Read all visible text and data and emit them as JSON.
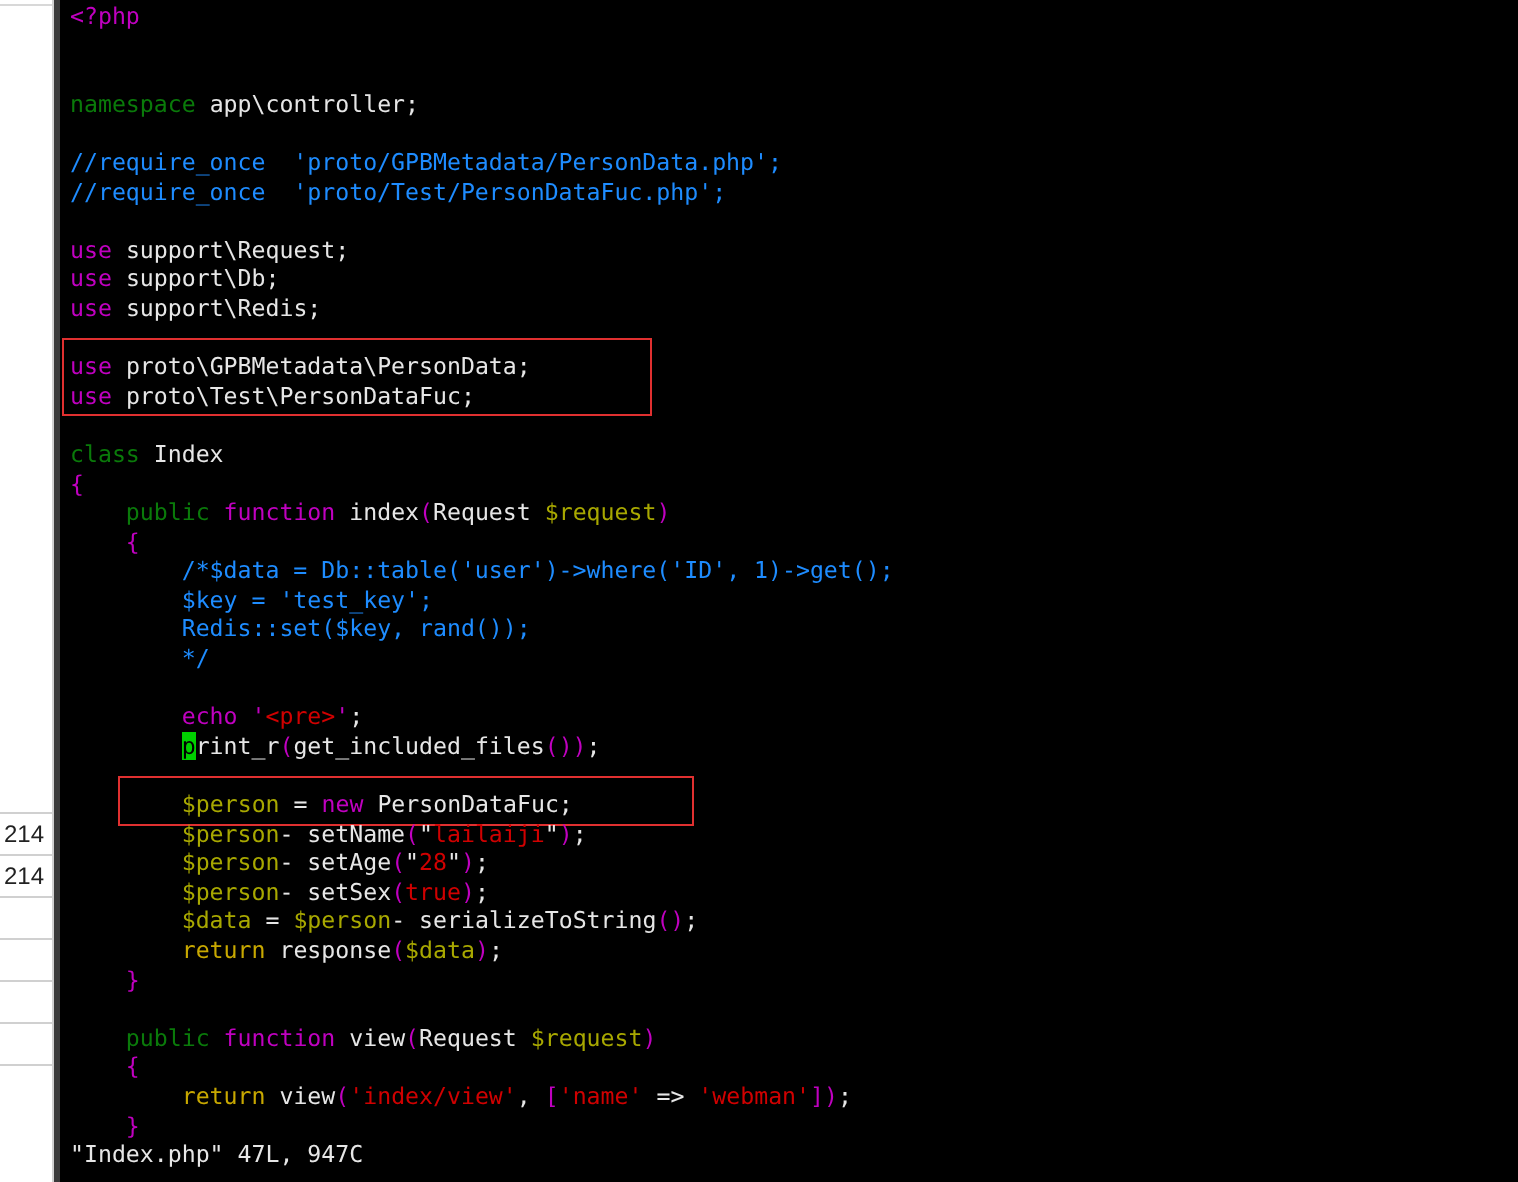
{
  "side_table": {
    "rows": [
      {
        "cell": "214"
      },
      {
        "cell": "214"
      }
    ]
  },
  "editor": {
    "blocks": [
      {
        "boxed": false,
        "lines": [
          {
            "kind": "code",
            "tokens": [
              {
                "kind": "statement",
                "text": "<?php"
              }
            ]
          },
          {
            "kind": "blank"
          },
          {
            "kind": "blank"
          },
          {
            "kind": "code",
            "tokens": [
              {
                "kind": "keyword",
                "text": "namespace"
              },
              {
                "kind": "text",
                "text": " app\\controller;"
              }
            ]
          },
          {
            "kind": "blank"
          },
          {
            "kind": "code",
            "tokens": [
              {
                "kind": "comment",
                "text": "//require_once  'proto/GPBMetadata/PersonData.php';"
              }
            ]
          },
          {
            "kind": "code",
            "tokens": [
              {
                "kind": "comment",
                "text": "//require_once  'proto/Test/PersonDataFuc.php';"
              }
            ]
          },
          {
            "kind": "blank"
          },
          {
            "kind": "code",
            "tokens": [
              {
                "kind": "statement",
                "text": "use"
              },
              {
                "kind": "text",
                "text": " support\\Request;"
              }
            ]
          },
          {
            "kind": "code",
            "tokens": [
              {
                "kind": "statement",
                "text": "use"
              },
              {
                "kind": "text",
                "text": " support\\Db;"
              }
            ]
          },
          {
            "kind": "code",
            "tokens": [
              {
                "kind": "statement",
                "text": "use"
              },
              {
                "kind": "text",
                "text": " support\\Redis;"
              }
            ]
          },
          {
            "kind": "blank"
          }
        ]
      },
      {
        "boxed": true,
        "lines": [
          {
            "kind": "code",
            "tokens": [
              {
                "kind": "statement",
                "text": "use"
              },
              {
                "kind": "text",
                "text": " proto\\GPBMetadata\\PersonData;"
              }
            ]
          },
          {
            "kind": "code",
            "tokens": [
              {
                "kind": "statement",
                "text": "use"
              },
              {
                "kind": "text",
                "text": " proto\\Test\\PersonDataFuc;"
              }
            ]
          }
        ]
      },
      {
        "boxed": false,
        "lines": [
          {
            "kind": "blank"
          },
          {
            "kind": "code",
            "tokens": [
              {
                "kind": "keyword",
                "text": "class"
              },
              {
                "kind": "text",
                "text": " Index"
              }
            ]
          },
          {
            "kind": "code",
            "tokens": [
              {
                "kind": "paren",
                "text": "{"
              }
            ]
          },
          {
            "kind": "code",
            "tokens": [
              {
                "kind": "keyword",
                "text": "    public"
              },
              {
                "kind": "statement",
                "text": " function"
              },
              {
                "kind": "text",
                "text": " index"
              },
              {
                "kind": "paren",
                "text": "("
              },
              {
                "kind": "text",
                "text": "Request "
              },
              {
                "kind": "variable",
                "text": "$request"
              },
              {
                "kind": "paren",
                "text": ")"
              }
            ]
          },
          {
            "kind": "code",
            "tokens": [
              {
                "kind": "paren",
                "text": "    {"
              }
            ]
          },
          {
            "kind": "code",
            "tokens": [
              {
                "kind": "comment",
                "text": "        /*$data = Db::table('user')->where('ID', 1)->get();"
              }
            ]
          },
          {
            "kind": "code",
            "tokens": [
              {
                "kind": "comment",
                "text": "        $key = 'test_key';"
              }
            ]
          },
          {
            "kind": "code",
            "tokens": [
              {
                "kind": "comment",
                "text": "        Redis::set($key, rand());"
              }
            ]
          },
          {
            "kind": "code",
            "tokens": [
              {
                "kind": "comment",
                "text": "        */"
              }
            ]
          },
          {
            "kind": "blank"
          },
          {
            "kind": "code",
            "tokens": [
              {
                "kind": "statement",
                "text": "        echo"
              },
              {
                "kind": "paren",
                "text": " '"
              },
              {
                "kind": "string",
                "text": "<pre>"
              },
              {
                "kind": "paren",
                "text": "'"
              },
              {
                "kind": "text",
                "text": ";"
              }
            ]
          },
          {
            "kind": "code",
            "tokens": [
              {
                "kind": "cursor",
                "text": "        p"
              },
              {
                "kind": "text",
                "text": "rint_r"
              },
              {
                "kind": "paren",
                "text": "("
              },
              {
                "kind": "text",
                "text": "get_included_files"
              },
              {
                "kind": "paren",
                "text": "())"
              },
              {
                "kind": "text",
                "text": ";"
              }
            ]
          },
          {
            "kind": "blank"
          }
        ]
      },
      {
        "boxed": true,
        "lines": [
          {
            "kind": "code",
            "tokens": [
              {
                "kind": "variable",
                "text": "        $person"
              },
              {
                "kind": "text",
                "text": " = "
              },
              {
                "kind": "statement",
                "text": "new"
              },
              {
                "kind": "text",
                "text": " PersonDataFuc;"
              }
            ]
          }
        ]
      },
      {
        "boxed": false,
        "lines": [
          {
            "kind": "code",
            "tokens": [
              {
                "kind": "variable",
                "text": "        $person"
              },
              {
                "kind": "text",
                "text": "- setName"
              },
              {
                "kind": "paren",
                "text": "("
              },
              {
                "kind": "text",
                "text": "\""
              },
              {
                "kind": "string",
                "text": "lailaiji"
              },
              {
                "kind": "text",
                "text": "\""
              },
              {
                "kind": "paren",
                "text": ")"
              },
              {
                "kind": "text",
                "text": ";"
              }
            ]
          },
          {
            "kind": "code",
            "tokens": [
              {
                "kind": "variable",
                "text": "        $person"
              },
              {
                "kind": "text",
                "text": "- setAge"
              },
              {
                "kind": "paren",
                "text": "("
              },
              {
                "kind": "text",
                "text": "\""
              },
              {
                "kind": "string",
                "text": "28"
              },
              {
                "kind": "text",
                "text": "\""
              },
              {
                "kind": "paren",
                "text": ")"
              },
              {
                "kind": "text",
                "text": ";"
              }
            ]
          },
          {
            "kind": "code",
            "tokens": [
              {
                "kind": "variable",
                "text": "        $person"
              },
              {
                "kind": "text",
                "text": "- setSex"
              },
              {
                "kind": "paren",
                "text": "("
              },
              {
                "kind": "string",
                "text": "true"
              },
              {
                "kind": "paren",
                "text": ")"
              },
              {
                "kind": "text",
                "text": ";"
              }
            ]
          },
          {
            "kind": "code",
            "tokens": [
              {
                "kind": "variable",
                "text": "        $data"
              },
              {
                "kind": "text",
                "text": " = "
              },
              {
                "kind": "variable",
                "text": "$person"
              },
              {
                "kind": "text",
                "text": "- serializeToString"
              },
              {
                "kind": "paren",
                "text": "()"
              },
              {
                "kind": "text",
                "text": ";"
              }
            ]
          },
          {
            "kind": "code",
            "tokens": [
              {
                "kind": "control",
                "text": "        return"
              },
              {
                "kind": "text",
                "text": " response"
              },
              {
                "kind": "paren",
                "text": "("
              },
              {
                "kind": "variable",
                "text": "$data"
              },
              {
                "kind": "paren",
                "text": ")"
              },
              {
                "kind": "text",
                "text": ";"
              }
            ]
          },
          {
            "kind": "code",
            "tokens": [
              {
                "kind": "paren",
                "text": "    }"
              }
            ]
          },
          {
            "kind": "blank"
          },
          {
            "kind": "code",
            "tokens": [
              {
                "kind": "keyword",
                "text": "    public"
              },
              {
                "kind": "statement",
                "text": " function"
              },
              {
                "kind": "text",
                "text": " view"
              },
              {
                "kind": "paren",
                "text": "("
              },
              {
                "kind": "text",
                "text": "Request "
              },
              {
                "kind": "variable",
                "text": "$request"
              },
              {
                "kind": "paren",
                "text": ")"
              }
            ]
          },
          {
            "kind": "code",
            "tokens": [
              {
                "kind": "paren",
                "text": "    {"
              }
            ]
          },
          {
            "kind": "code",
            "tokens": [
              {
                "kind": "control",
                "text": "        return"
              },
              {
                "kind": "text",
                "text": " view"
              },
              {
                "kind": "paren",
                "text": "("
              },
              {
                "kind": "string",
                "text": "'index/view'"
              },
              {
                "kind": "text",
                "text": ", "
              },
              {
                "kind": "paren",
                "text": "["
              },
              {
                "kind": "string",
                "text": "'name'"
              },
              {
                "kind": "text",
                "text": " => "
              },
              {
                "kind": "string",
                "text": "'webman'"
              },
              {
                "kind": "paren",
                "text": "])"
              },
              {
                "kind": "text",
                "text": ";"
              }
            ]
          },
          {
            "kind": "code",
            "tokens": [
              {
                "kind": "paren",
                "text": "    }"
              }
            ]
          }
        ]
      }
    ],
    "status_line": "\"Index.php\" 47L, 947C"
  }
}
